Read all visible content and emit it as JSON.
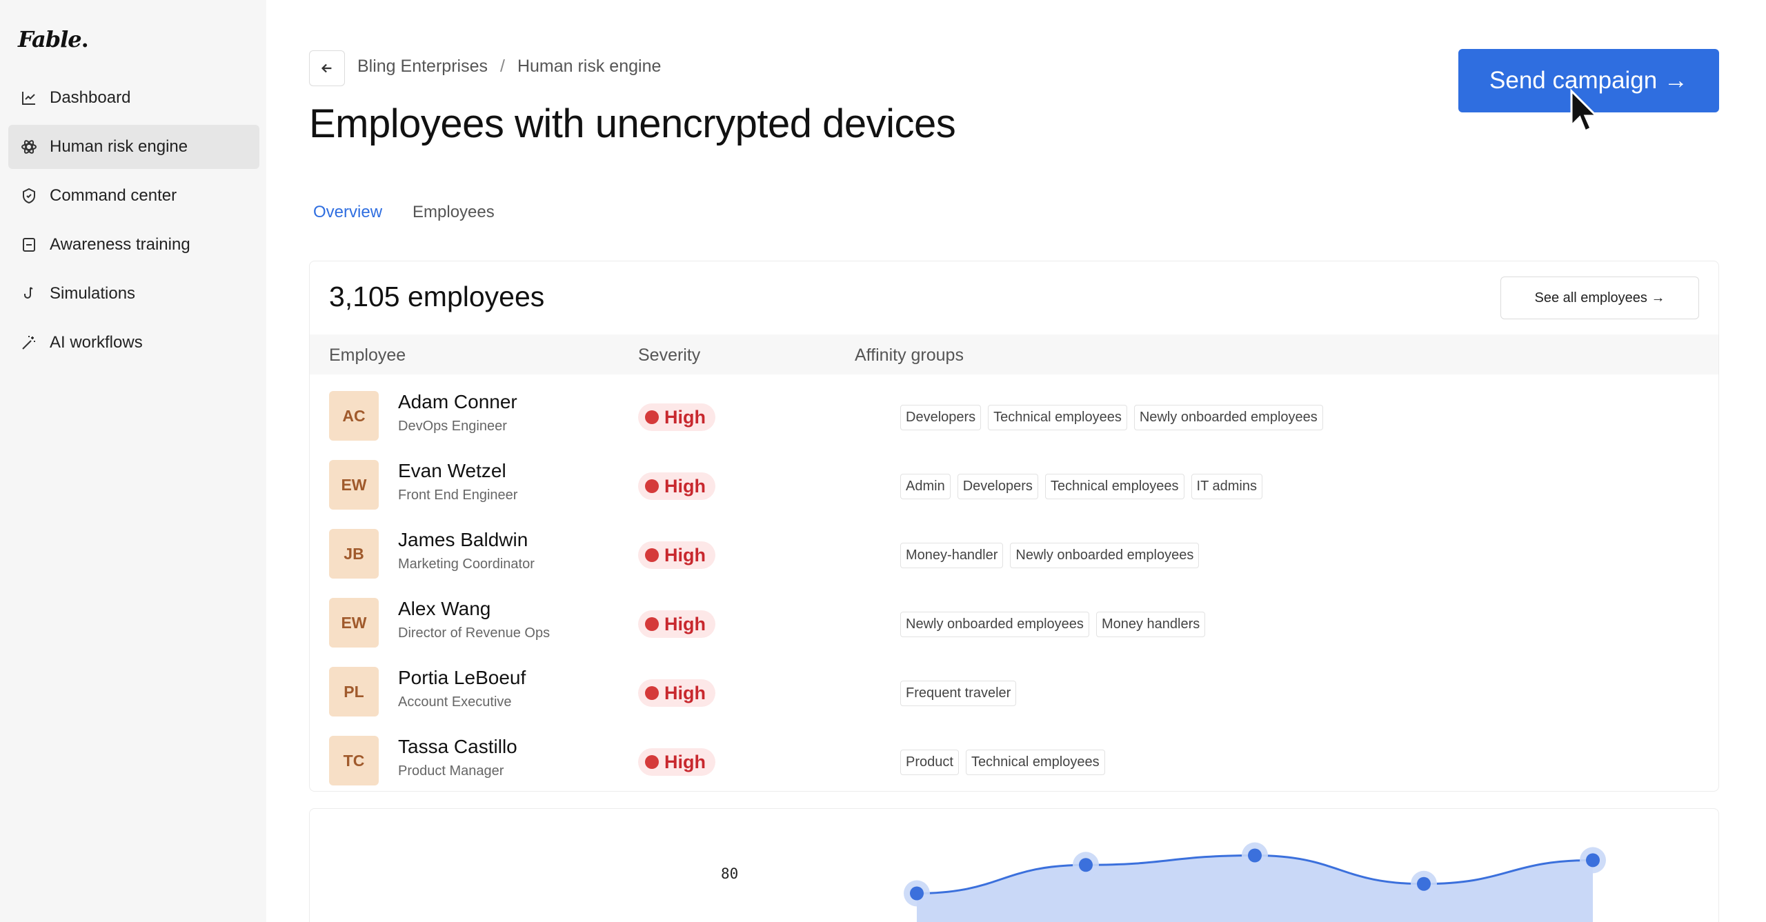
{
  "sidebar": {
    "logo": "Fable",
    "items": [
      {
        "label": "Dashboard",
        "icon": "chart-line-icon"
      },
      {
        "label": "Human risk engine",
        "icon": "atom-icon",
        "active": true
      },
      {
        "label": "Command center",
        "icon": "shield-icon"
      },
      {
        "label": "Awareness training",
        "icon": "book-icon"
      },
      {
        "label": "Simulations",
        "icon": "fishhook-icon"
      },
      {
        "label": "AI workflows",
        "icon": "magic-wand-icon"
      }
    ]
  },
  "header": {
    "breadcrumb": [
      "Bling Enterprises",
      "/",
      "Human risk engine"
    ],
    "title": "Employees with unencrypted devices",
    "send_label": "Send campaign →"
  },
  "tabs": [
    {
      "label": "Overview",
      "active": true
    },
    {
      "label": "Employees",
      "active": false
    }
  ],
  "employees_card": {
    "title": "3,105 employees",
    "see_all_label": "See all employees →",
    "columns": [
      "Employee",
      "Severity",
      "Affinity groups"
    ],
    "rows": [
      {
        "initials": "AC",
        "name": "Adam Conner",
        "role": "DevOps Engineer",
        "severity": "High",
        "groups": [
          "Developers",
          "Technical employees",
          "Newly onboarded employees"
        ]
      },
      {
        "initials": "EW",
        "name": "Evan Wetzel",
        "role": "Front End Engineer",
        "severity": "High",
        "groups": [
          "Admin",
          "Developers",
          "Technical employees",
          "IT admins"
        ]
      },
      {
        "initials": "JB",
        "name": "James Baldwin",
        "role": "Marketing Coordinator",
        "severity": "High",
        "groups": [
          "Money-handler",
          "Newly onboarded employees"
        ]
      },
      {
        "initials": "EW",
        "name": "Alex Wang",
        "role": "Director of Revenue Ops",
        "severity": "High",
        "groups": [
          "Newly onboarded employees",
          "Money handlers"
        ]
      },
      {
        "initials": "PL",
        "name": "Portia LeBoeuf",
        "role": "Account Executive",
        "severity": "High",
        "groups": [
          "Frequent traveler"
        ]
      },
      {
        "initials": "TC",
        "name": "Tassa Castillo",
        "role": "Product Manager",
        "severity": "High",
        "groups": [
          "Product",
          "Technical employees"
        ]
      }
    ]
  },
  "chart_data": {
    "type": "area",
    "y_tick_label": "80",
    "values": [
      76,
      79,
      80,
      77,
      79.5
    ],
    "ylim": [
      74,
      82
    ]
  },
  "colors": {
    "accent": "#2f6ee0",
    "severity_high": "#c8282e",
    "avatar_bg": "#f7dfc6",
    "chart_line": "#3b70dc",
    "chart_fill": "#c9d8f7"
  }
}
